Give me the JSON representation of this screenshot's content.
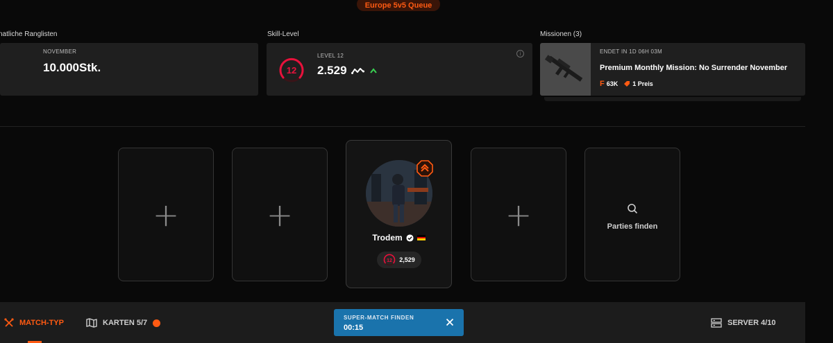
{
  "queue": {
    "label": "Europe 5v5 Queue"
  },
  "rankings": {
    "section_title": "natliche Ranglisten",
    "month": "NOVEMBER",
    "value": "10.000Stk."
  },
  "skill": {
    "section_title": "Skill-Level",
    "level_label": "LEVEL 12",
    "level_number": "12",
    "elo": "2.529",
    "info": "i"
  },
  "missions": {
    "section_title": "Missionen (3)",
    "ends": "ENDET IN 1D 06H 03M",
    "title": "Premium Monthly Mission: No Surrender November",
    "reward_points": "63K",
    "reward_prizes": "1 Preis"
  },
  "party": {
    "find_label": "Parties finden",
    "player": {
      "name": "Trodem",
      "level": "12",
      "elo": "2,529"
    }
  },
  "bottom": {
    "match_type": "MATCH-TYP",
    "maps": "KARTEN 5/7",
    "server": "SERVER 4/10",
    "find_match": "SUPER-MATCH FINDEN",
    "timer": "00:15"
  },
  "colors": {
    "accent": "#ff5a12",
    "level_red": "#e8123c",
    "button_blue": "#1a73ac",
    "trend_green": "#39d353"
  }
}
